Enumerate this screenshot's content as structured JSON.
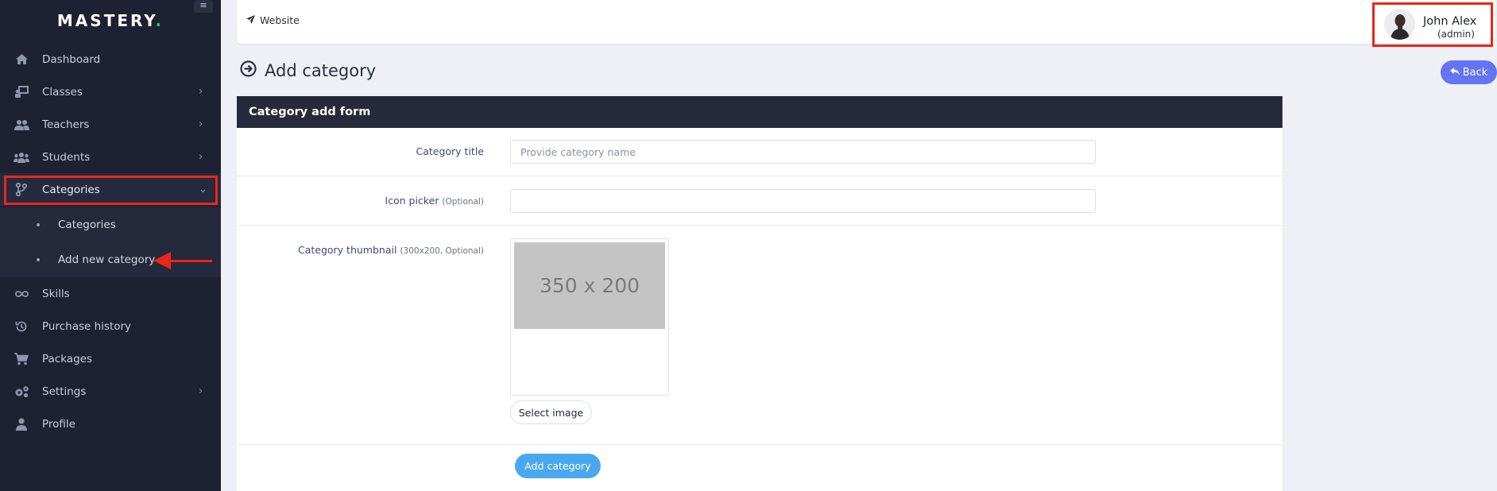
{
  "brand": {
    "name": "MASTERY",
    "dot": "."
  },
  "sidebar": {
    "items": [
      {
        "label": "Dashboard",
        "icon": "home-icon"
      },
      {
        "label": "Classes",
        "icon": "chalkboard-icon",
        "chevron": "›"
      },
      {
        "label": "Teachers",
        "icon": "users-icon",
        "chevron": "›"
      },
      {
        "label": "Students",
        "icon": "user-group-icon",
        "chevron": "›"
      },
      {
        "label": "Categories",
        "icon": "branch-icon",
        "chevron": "⌄"
      },
      {
        "label": "Skills",
        "icon": "infinity-icon"
      },
      {
        "label": "Purchase history",
        "icon": "history-icon"
      },
      {
        "label": "Packages",
        "icon": "cart-icon"
      },
      {
        "label": "Settings",
        "icon": "gears-icon",
        "chevron": "›"
      },
      {
        "label": "Profile",
        "icon": "user-icon"
      }
    ],
    "submenu": [
      {
        "label": "Categories"
      },
      {
        "label": "Add new category"
      }
    ]
  },
  "topbar": {
    "website_label": "Website",
    "user_name": "John Alex",
    "user_role": "(admin)"
  },
  "page": {
    "title": "Add category",
    "back_label": "Back"
  },
  "form": {
    "header": "Category add form",
    "title_label": "Category title",
    "title_placeholder": "Provide category name",
    "title_value": "",
    "icon_label": "Icon picker",
    "icon_optional": "(Optional)",
    "icon_value": "",
    "thumb_label": "Category thumbnail",
    "thumb_optional": "(300x200, Optional)",
    "thumb_placeholder_text": "350 x 200",
    "select_image_label": "Select image",
    "submit_label": "Add category"
  },
  "colors": {
    "sidebar_bg": "#1e2131",
    "highlight": "#e8261b",
    "back_button": "#6574f3",
    "submit_button": "#4aa8f0"
  }
}
